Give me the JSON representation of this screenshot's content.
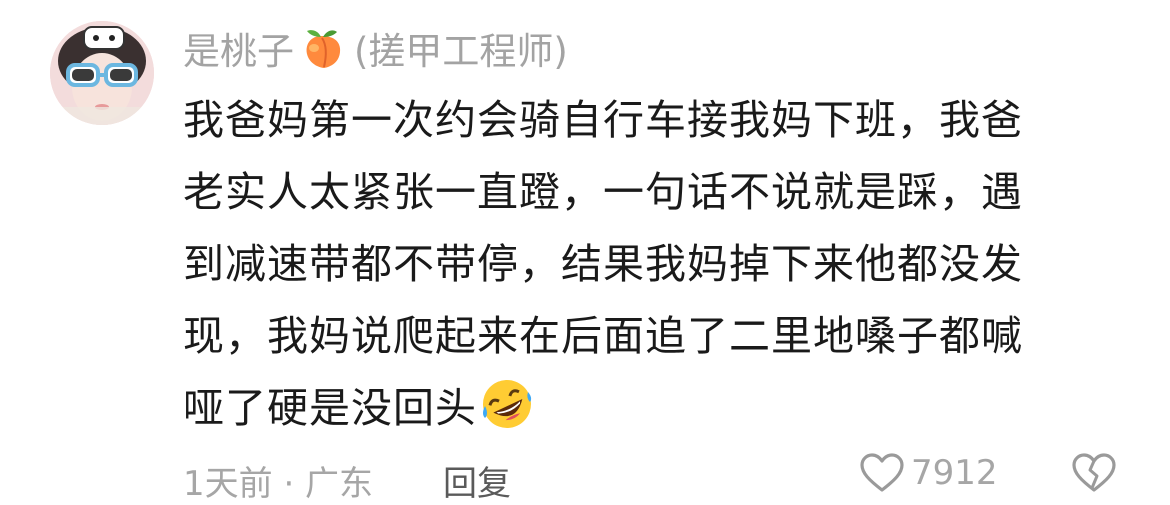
{
  "comment": {
    "author": {
      "name": "是桃子",
      "badge_icon": "peach-emoji",
      "verification": "(搓甲工程师)"
    },
    "lines": [
      "我爸妈第一次约会骑自行车接我妈下班，我爸",
      "老实人太紧张一直蹬，一句话不说就是踩，遇",
      "到减速带都不带停，结果我妈掉下来他都没发",
      "现，我妈说爬起来在后面追了二里地嗓子都喊",
      "哑了硬是没回头"
    ],
    "end_emoji": "rolling-laughing-emoji",
    "footer": {
      "meta": "1天前 · 广东",
      "reply_label": "回复",
      "like_icon": "heart-outline-icon",
      "like_count": "7912",
      "dislike_icon": "broken-heart-outline-icon"
    }
  }
}
